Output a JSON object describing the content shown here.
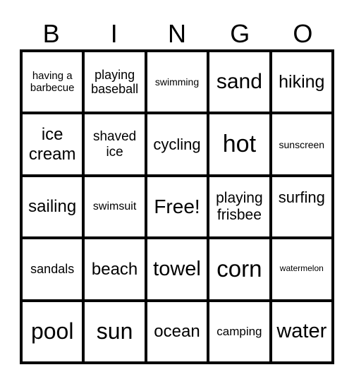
{
  "header": [
    "B",
    "I",
    "N",
    "G",
    "O"
  ],
  "cells": [
    {
      "text": "having a barbecue",
      "size": 15
    },
    {
      "text": "playing baseball",
      "size": 18
    },
    {
      "text": "swimming",
      "size": 14
    },
    {
      "text": "sand",
      "size": 30
    },
    {
      "text": "hiking",
      "size": 25
    },
    {
      "text": "ice cream",
      "size": 24
    },
    {
      "text": "shaved ice",
      "size": 19
    },
    {
      "text": "cycling",
      "size": 22
    },
    {
      "text": "hot",
      "size": 34
    },
    {
      "text": "sunscreen",
      "size": 14
    },
    {
      "text": "sailing",
      "size": 24
    },
    {
      "text": "swimsuit",
      "size": 16
    },
    {
      "text": "Free!",
      "size": 28
    },
    {
      "text": "playing frisbee",
      "size": 21
    },
    {
      "text": "surfing",
      "size": 22,
      "align": "top"
    },
    {
      "text": "sandals",
      "size": 18
    },
    {
      "text": "beach",
      "size": 24
    },
    {
      "text": "towel",
      "size": 29
    },
    {
      "text": "corn",
      "size": 33
    },
    {
      "text": "watermelon",
      "size": 12
    },
    {
      "text": "pool",
      "size": 32
    },
    {
      "text": "sun",
      "size": 32
    },
    {
      "text": "ocean",
      "size": 24
    },
    {
      "text": "camping",
      "size": 17
    },
    {
      "text": "water",
      "size": 29
    }
  ]
}
